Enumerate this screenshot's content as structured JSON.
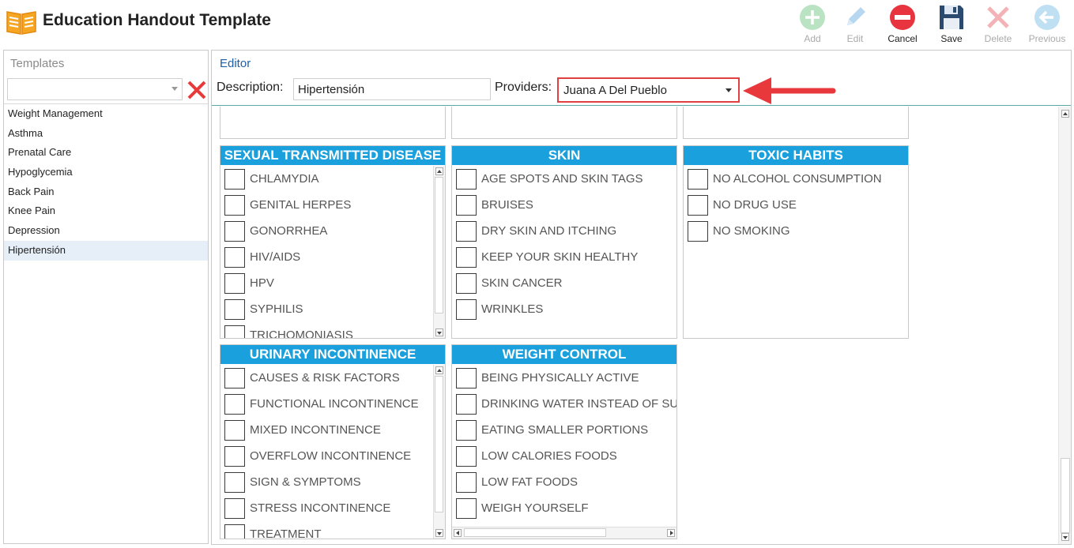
{
  "app": {
    "title": "Education Handout Template"
  },
  "toolbar": {
    "add_label": "Add",
    "edit_label": "Edit",
    "cancel_label": "Cancel",
    "save_label": "Save",
    "delete_label": "Delete",
    "previous_label": "Previous"
  },
  "templates": {
    "title": "Templates",
    "search_value": "",
    "items": [
      "Weight Management",
      "Asthma",
      "Prenatal Care",
      "Hypoglycemia",
      "Back Pain",
      "Knee Pain",
      "Depression",
      "Hipertensión"
    ],
    "selected": "Hipertensión"
  },
  "editor": {
    "title": "Editor",
    "description_label": "Description:",
    "description_value": "Hipertensión",
    "providers_label": "Providers:",
    "providers_value": "Juana A Del Pueblo"
  },
  "categories": [
    {
      "title": "SEXUAL TRANSMITTED DISEASE",
      "items": [
        "CHLAMYDIA",
        "GENITAL HERPES",
        "GONORRHEA",
        "HIV/AIDS",
        "HPV",
        "SYPHILIS",
        "TRICHOMONIASIS"
      ]
    },
    {
      "title": "SKIN",
      "items": [
        "AGE SPOTS AND SKIN TAGS",
        "BRUISES",
        "DRY SKIN AND ITCHING",
        "KEEP YOUR SKIN HEALTHY",
        "SKIN CANCER",
        "WRINKLES"
      ]
    },
    {
      "title": "TOXIC HABITS",
      "items": [
        "NO ALCOHOL CONSUMPTION",
        "NO DRUG USE",
        "NO SMOKING"
      ]
    },
    {
      "title": "URINARY INCONTINENCE",
      "items": [
        "CAUSES & RISK FACTORS",
        "FUNCTIONAL INCONTINENCE",
        "MIXED INCONTINENCE",
        "OVERFLOW INCONTINENCE",
        "SIGN & SYMPTOMS",
        "STRESS INCONTINENCE",
        "TREATMENT"
      ]
    },
    {
      "title": "WEIGHT CONTROL",
      "items": [
        "BEING PHYSICALLY ACTIVE",
        "DRINKING WATER INSTEAD OF SUGARY DRINKS",
        "EATING SMALLER PORTIONS",
        "LOW CALORIES FOODS",
        "LOW FAT FOODS",
        "WEIGH YOURSELF"
      ]
    }
  ],
  "colors": {
    "category_header": "#1aa0dc",
    "highlight": "#e04040",
    "editor_title": "#1e5fa8",
    "selected_row": "#e6eff8"
  }
}
